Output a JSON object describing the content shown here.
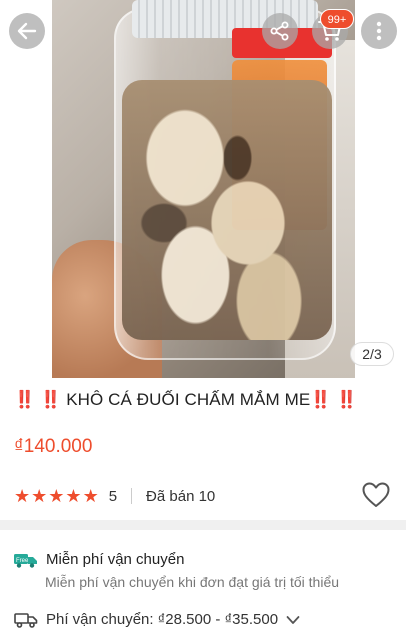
{
  "top_bar": {
    "cart_badge": "99+",
    "image_counter": "2/3"
  },
  "product": {
    "title_prefix": "‼️ ‼️",
    "title_text": "KHÔ CÁ ĐUỐI CHẤM MẮM ME",
    "title_suffix": "‼️ ‼️",
    "price": "₫140.000",
    "rating_value": 5,
    "rating_label": "5",
    "sold_label": "Đã bán 10"
  },
  "shipping": {
    "title": "Miễn phí vận chuyển",
    "subtitle": "Miễn phí vận chuyển khi đơn đạt giá trị tối thiểu",
    "fee_label": "Phí vận chuyển:",
    "fee_value": "₫28.500 - ₫35.500"
  },
  "icons": {
    "back": "arrow-left-icon",
    "share": "share-icon",
    "cart": "cart-icon",
    "more": "more-vertical-icon",
    "heart": "heart-outline-icon",
    "free_ship": "free-ship-truck-icon",
    "fee_truck": "truck-icon",
    "chevron": "chevron-down-icon"
  },
  "colors": {
    "accent": "#ee4d2d",
    "free_ship_icon": "#26aa99"
  }
}
